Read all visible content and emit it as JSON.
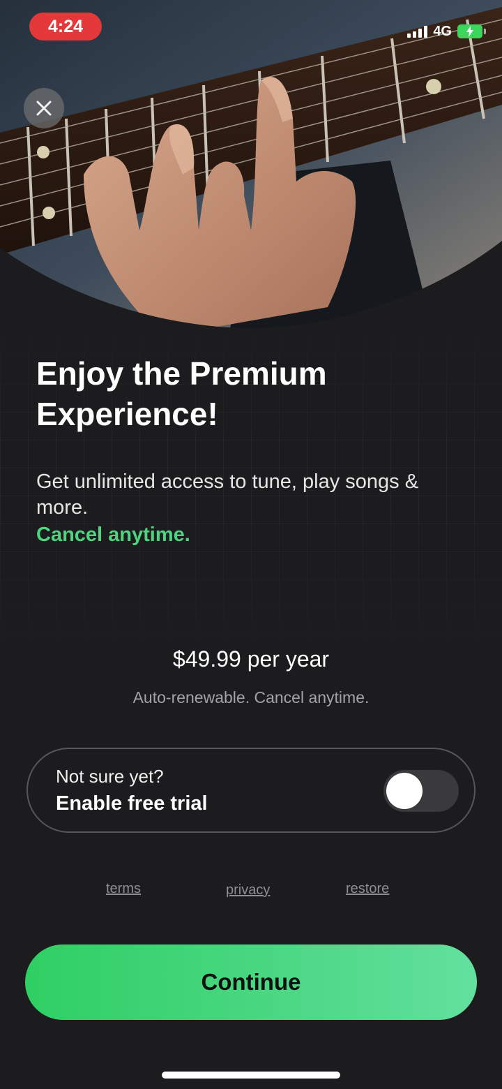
{
  "status_bar": {
    "time": "4:24",
    "network": "4G"
  },
  "hero": {
    "image": "guitar-fretboard-hand-photo"
  },
  "close_icon": "close-icon",
  "content": {
    "title": "Enjoy the Premium Experience!",
    "subtitle": "Get unlimited access to tune, play songs & more.",
    "cancel_note": "Cancel anytime.",
    "price": "$49.99 per year",
    "renew_note": "Auto-renewable. Cancel anytime."
  },
  "trial": {
    "question": "Not sure yet?",
    "label": "Enable free trial",
    "enabled": false
  },
  "links": {
    "terms": "terms",
    "privacy": "privacy",
    "restore": "restore"
  },
  "continue_label": "Continue",
  "colors": {
    "accent_green": "#4cd47f",
    "button_green": "#2fcf63",
    "background": "#1c1c1e",
    "time_pill": "#e5383b"
  }
}
